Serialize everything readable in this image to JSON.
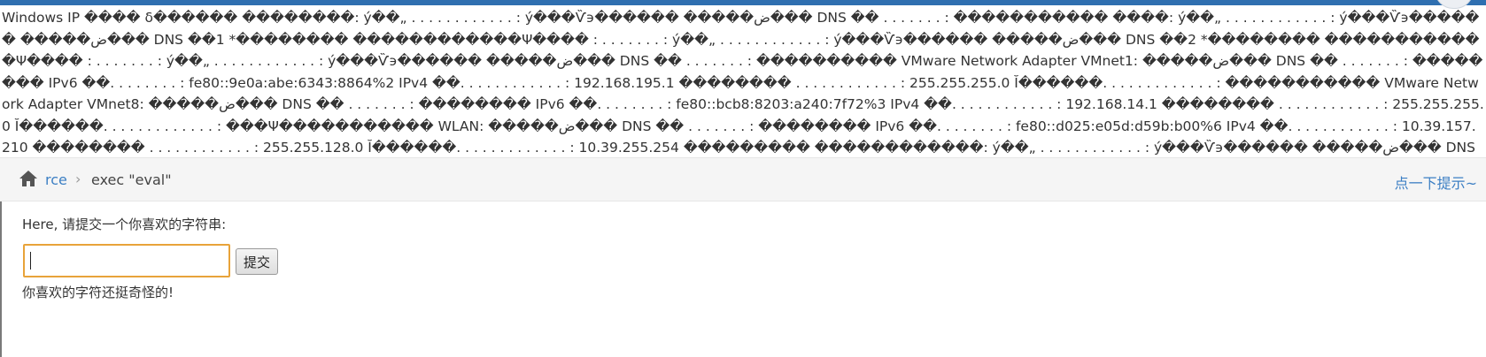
{
  "command_output": "Windows IP ���� δ������ ��������: ý��„ . . . . . . . . . . . . : ý���Ѷ϶������ �����ض��� DNS �� . . . . . . . : ����������� ����: ý��„ . . . . . . . . . . . . : ý���Ѷ϶������ �����ض��� DNS ��1 *�������� ������������Ψ���� : . . . . . . . : ý��„ . . . . . . . . . . . . : ý���Ѷ϶������ �����ض��� DNS ��2 *�������� ������������Ψ���� : . . . . . . . : ý��„ . . . . . . . . . . . . : ý���Ѷ϶������ �����ض��� DNS �� . . . . . . . : ���������� VMware Network Adapter VMnet1: �����ض��� DNS �� . . . . . . . : �������� IPv6 ��. . . . . . . . : fe80::9e0a:abe:6343:8864%2 IPv4 ��. . . . . . . . . . . . : 192.168.195.1 �������� . . . . . . . . . . . . : 255.255.255.0 Ĭ������. . . . . . . . . . . . . : ����������� VMware Network Adapter VMnet8: �����ض��� DNS �� . . . . . . . : �������� IPv6 ��. . . . . . . . : fe80::bcb8:8203:a240:7f72%3 IPv4 ��. . . . . . . . . . . . : 192.168.14.1 �������� . . . . . . . . . . . . : 255.255.255.0 Ĭ������. . . . . . . . . . . . . : ���Ψ����������� WLAN: �����ض��� DNS �� . . . . . . . : �������� IPv6 ��. . . . . . . . : fe80::d025:e05d:d59b:b00%6 IPv4 ��. . . . . . . . . . . . : 10.39.157.210 �������� . . . . . . . . . . . . : 255.255.128.0 Ĭ������. . . . . . . . . . . . . : 10.39.255.254 ��������� ������������: ý��„ . . . . . . . . . . . . : ý���Ѷ϶������ �����ض��� DNS �� . . . . . . . :",
  "breadcrumb": {
    "home_icon": "home-icon",
    "root_label": "rce",
    "separator": "›",
    "current_label": "exec \"eval\""
  },
  "hint_link": "点一下提示~",
  "form": {
    "prompt": "Here, 请提交一个你喜欢的字符串:",
    "input_value": "",
    "submit_label": "提交"
  },
  "result_message": "你喜欢的字符还挺奇怪的!",
  "colors": {
    "link": "#3c7fc4",
    "input_border_focus": "#e8a33a",
    "breadcrumb_bg": "#f5f5f5",
    "top_strip": "#2f6fb0"
  }
}
